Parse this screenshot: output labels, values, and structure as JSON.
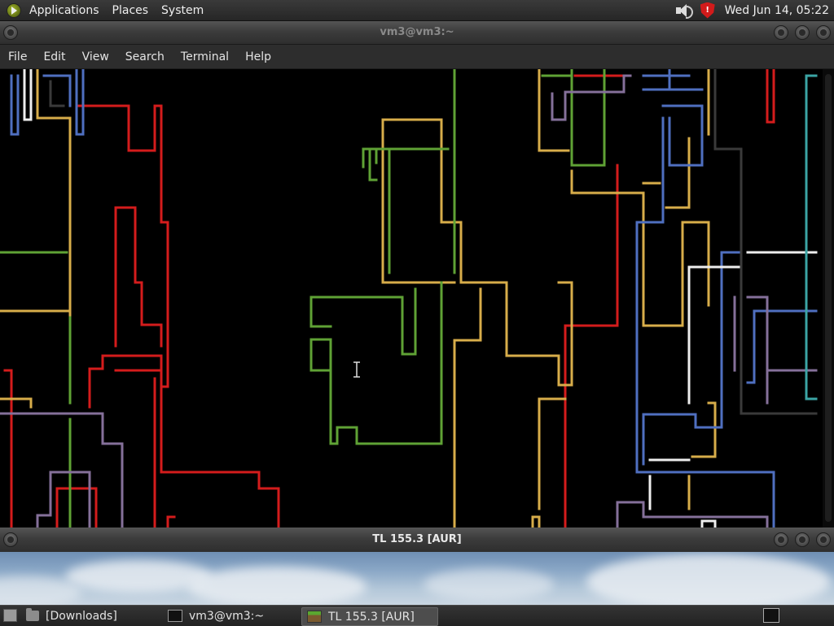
{
  "top_panel": {
    "menus": [
      "Applications",
      "Places",
      "System"
    ],
    "clock": "Wed Jun 14, 05:22",
    "shield_glyph": "!"
  },
  "terminal_window": {
    "title": "vm3@vm3:~",
    "menu": [
      "File",
      "Edit",
      "View",
      "Search",
      "Terminal",
      "Help"
    ]
  },
  "game_window": {
    "title": "TL 155.3 [AUR]"
  },
  "taskbar": {
    "tasks": [
      "[Downloads]",
      "vm3@vm3:~",
      "TL 155.3 [AUR]"
    ]
  },
  "colors": {
    "red": "#d41c1c",
    "yellow": "#d7ad4a",
    "green": "#5fa235",
    "blue": "#4f6fc0",
    "white": "#eeeeee",
    "purple": "#85709a",
    "cyan": "#3ba5a5",
    "gray": "#3a3a3a"
  }
}
